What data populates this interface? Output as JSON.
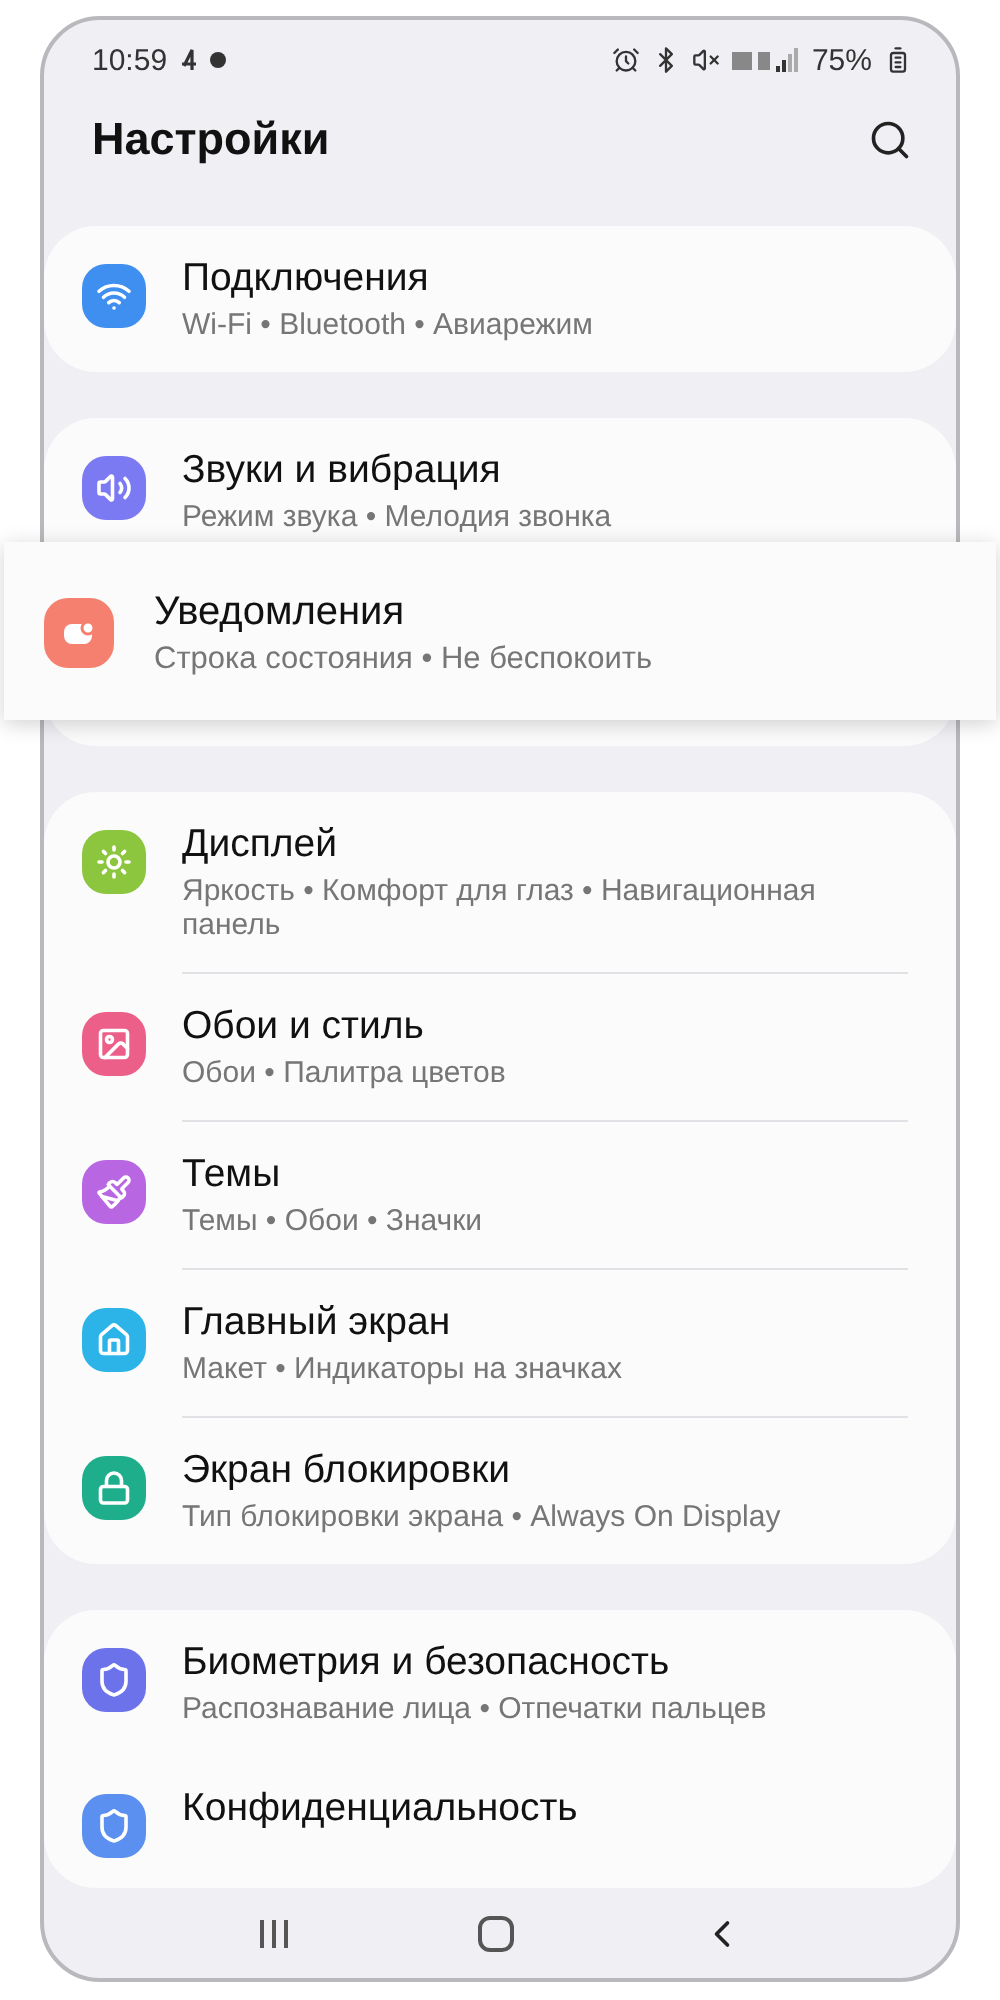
{
  "status_bar": {
    "time": "10:59",
    "battery": "75%"
  },
  "header": {
    "title": "Настройки"
  },
  "groups": [
    {
      "items": [
        {
          "title": "Подключения",
          "subtitle": "Wi-Fi • Bluetooth • Авиарежим",
          "color": "#3f8ff0",
          "selected": false
        }
      ]
    },
    {
      "items": [
        {
          "title": "Звуки и вибрация",
          "subtitle": "Режим звука • Мелодия звонка",
          "color": "#7c7af2",
          "selected": false
        },
        {
          "title": "Уведомления",
          "subtitle": "Строка состояния • Не беспокоить",
          "color": "#f5806f",
          "selected": true
        }
      ]
    },
    {
      "items": [
        {
          "title": "Дисплей",
          "subtitle": "Яркость • Комфорт для глаз • Навигационная панель",
          "color": "#8cc63f",
          "selected": false
        },
        {
          "title": "Обои и стиль",
          "subtitle": "Обои • Палитра цветов",
          "color": "#ec5f88",
          "selected": false
        },
        {
          "title": "Темы",
          "subtitle": "Темы • Обои • Значки",
          "color": "#b866e2",
          "selected": false
        },
        {
          "title": "Главный экран",
          "subtitle": "Макет • Индикаторы на значках",
          "color": "#2cb4e8",
          "selected": false
        },
        {
          "title": "Экран блокировки",
          "subtitle": "Тип блокировки экрана • Always On Display",
          "color": "#1fae8c",
          "selected": false
        }
      ]
    },
    {
      "items": [
        {
          "title": "Биометрия и безопасность",
          "subtitle": "Распознавание лица • Отпечатки пальцев",
          "color": "#6c72ea",
          "selected": false
        },
        {
          "title": "Конфиденциальность",
          "color": "#5b8ff0",
          "selected": false
        }
      ]
    }
  ]
}
